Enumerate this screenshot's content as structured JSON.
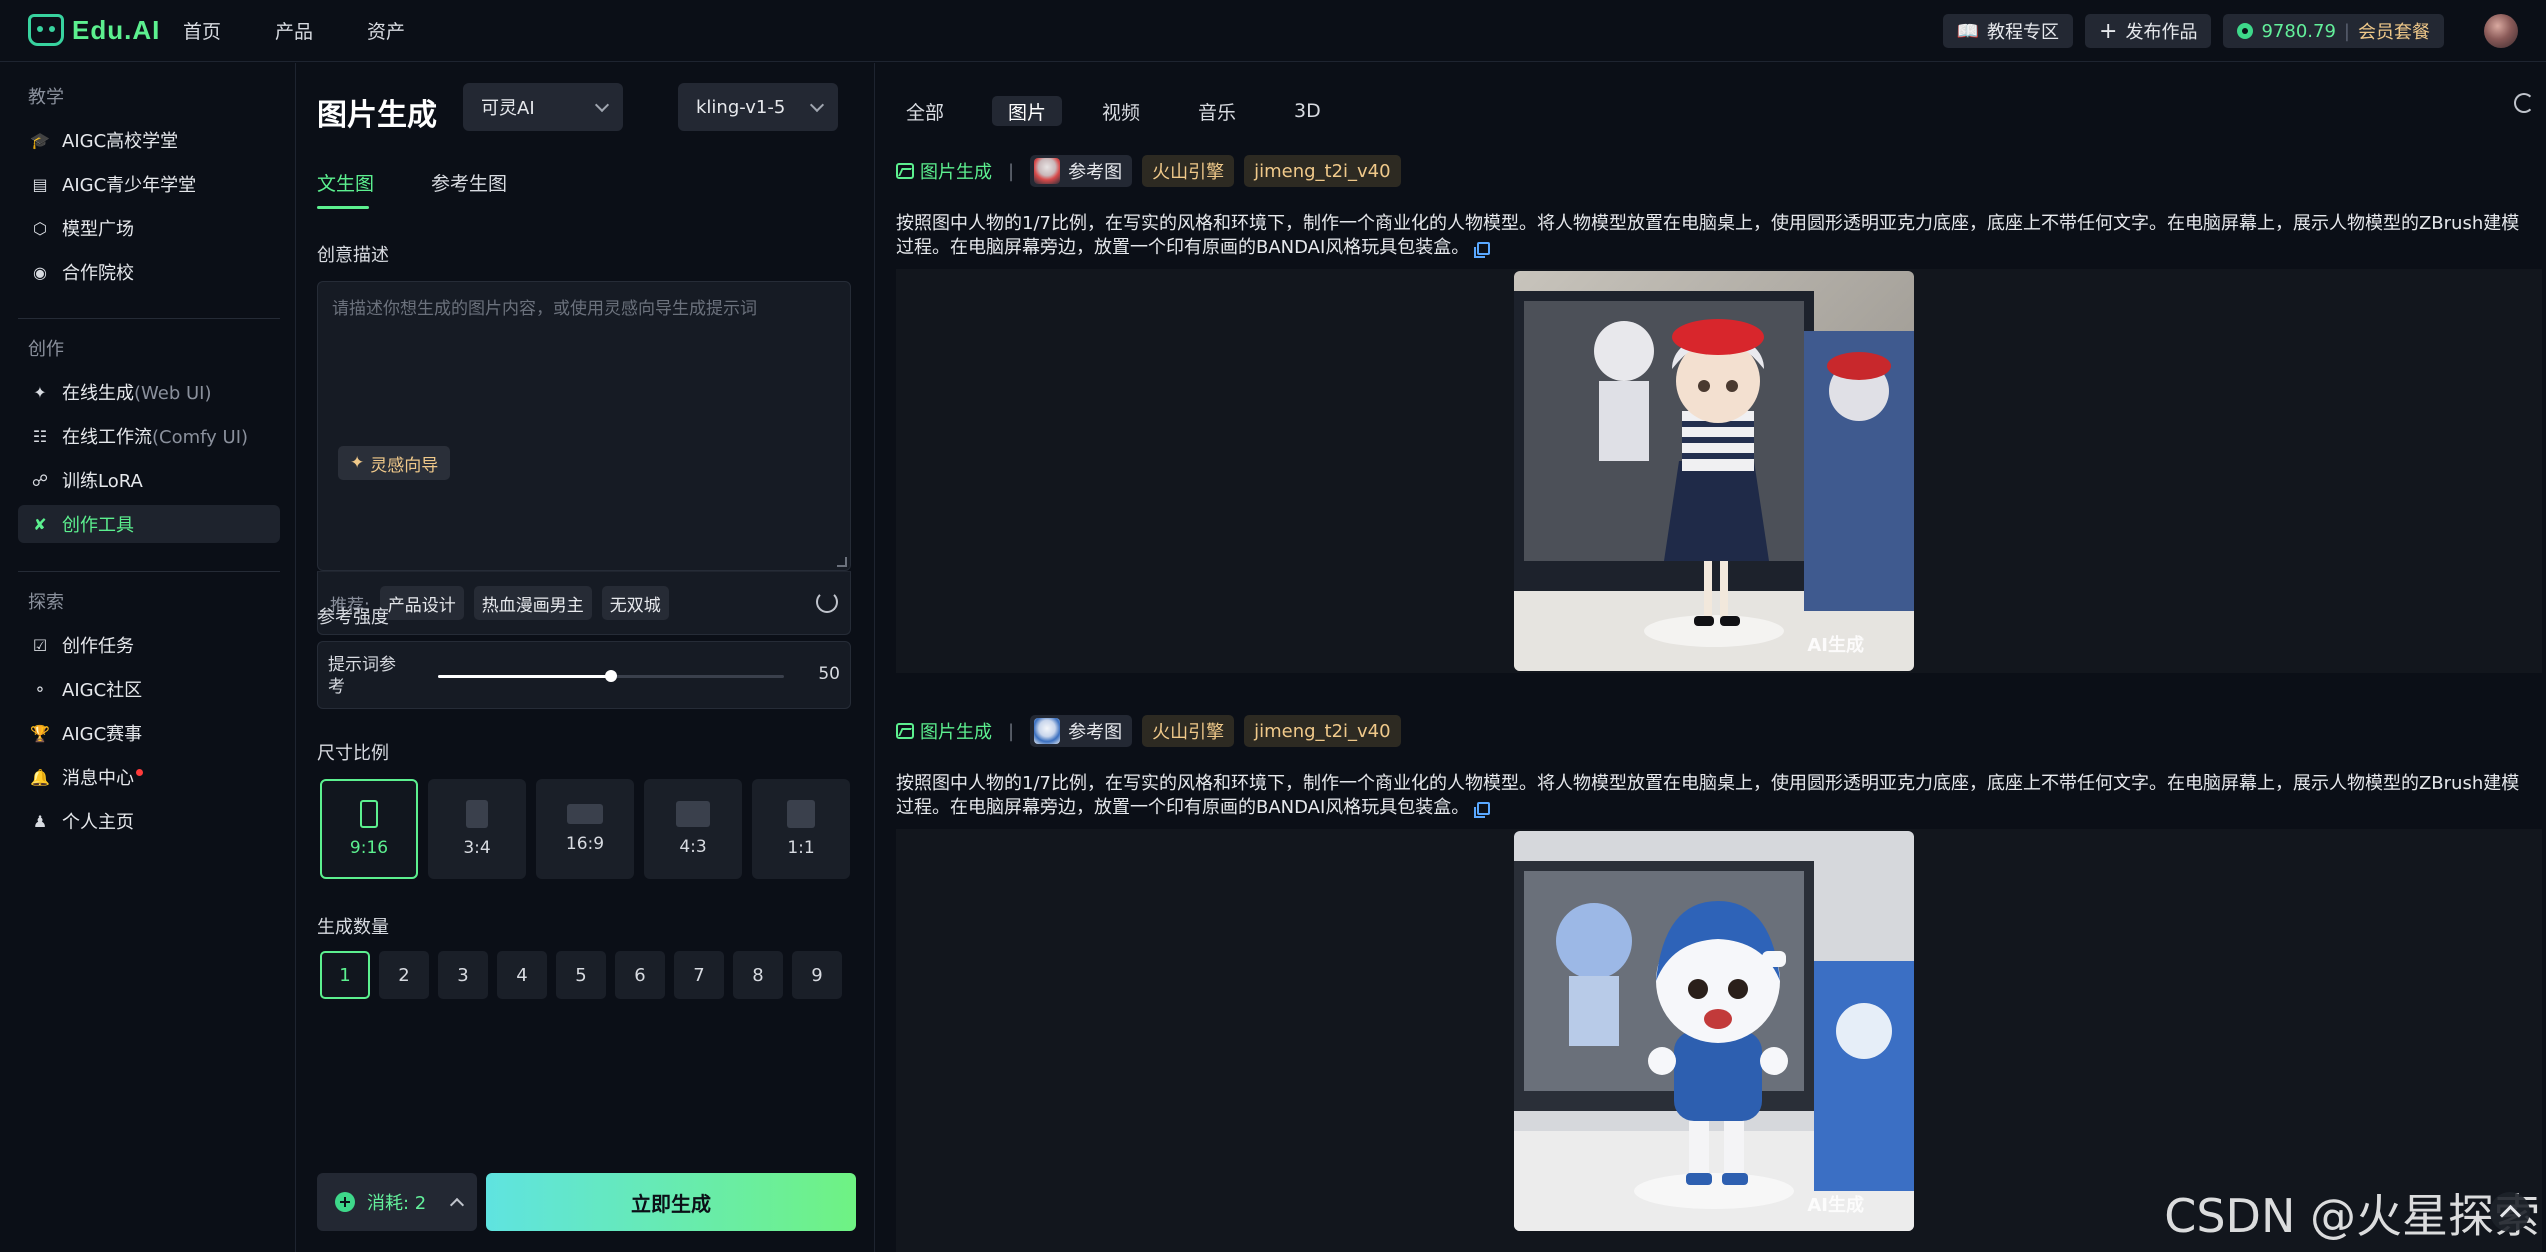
{
  "brand": {
    "logo_text": "Edu.AI",
    "accent": "#5cf08f"
  },
  "topnav": [
    "首页",
    "产品",
    "资产"
  ],
  "topright": {
    "tutorial": "教程专区",
    "publish": "发布作品",
    "credits": "9780.79",
    "member": "会员套餐"
  },
  "sidebar": {
    "sections": [
      {
        "title": "教学",
        "items": [
          {
            "label": "AIGC高校学堂",
            "icon": "graduation-cap-icon"
          },
          {
            "label": "AIGC青少年学堂",
            "icon": "book-icon"
          },
          {
            "label": "模型广场",
            "icon": "cube-icon"
          },
          {
            "label": "合作院校",
            "icon": "location-pin-icon"
          }
        ]
      },
      {
        "title": "创作",
        "items": [
          {
            "label": "在线生成",
            "sub": "(Web UI)",
            "icon": "sparkle-icon"
          },
          {
            "label": "在线工作流",
            "sub": "(Comfy UI)",
            "icon": "workflow-icon"
          },
          {
            "label": "训练LoRA",
            "icon": "model-icon"
          },
          {
            "label": "创作工具",
            "icon": "tools-icon",
            "active": true
          }
        ]
      },
      {
        "title": "探索",
        "items": [
          {
            "label": "创作任务",
            "icon": "clipboard-icon"
          },
          {
            "label": "AIGC社区",
            "icon": "planet-icon"
          },
          {
            "label": "AIGC赛事",
            "icon": "trophy-icon"
          },
          {
            "label": "消息中心",
            "icon": "bell-icon",
            "badge": true
          },
          {
            "label": "个人主页",
            "icon": "user-icon"
          }
        ]
      }
    ]
  },
  "panel": {
    "title": "图片生成",
    "provider": "可灵AI",
    "model": "kling-v1-5",
    "tabs": [
      "文生图",
      "参考生图"
    ],
    "desc_label": "创意描述",
    "desc_placeholder": "请描述你想生成的图片内容，或使用灵感向导生成提示词",
    "inspire": "灵感向导",
    "rec_label": "推荐:",
    "rec_chips": [
      "产品设计",
      "热血漫画男主",
      "无双城"
    ],
    "strength_label": "参考强度",
    "slider_label": "提示词参考",
    "slider_value": "50",
    "slider_fraction": 0.5,
    "ratio_label": "尺寸比例",
    "ratios": [
      "9:16",
      "3:4",
      "16:9",
      "4:3",
      "1:1"
    ],
    "selected_ratio": "9:16",
    "qty_label": "生成数量",
    "qtys": [
      "1",
      "2",
      "3",
      "4",
      "5",
      "6",
      "7",
      "8",
      "9"
    ],
    "selected_qty": "1",
    "cost": "消耗: 2",
    "generate": "立即生成"
  },
  "main": {
    "filters": [
      "全部",
      "图片",
      "视频",
      "音乐",
      "3D"
    ],
    "active_filter": "图片",
    "results": [
      {
        "type_label": "图片生成",
        "ref_label": "参考图",
        "engine": "火山引擎",
        "model": "jimeng_t2i_v40",
        "prompt": "按照图中人物的1/7比例，在写实的风格和环境下，制作一个商业化的人物模型。将人物模型放置在电脑桌上，使用圆形透明亚克力底座，底座上不带任何文字。在电脑屏幕上，展示人物模型的ZBrush建模过程。在电脑屏幕旁边，放置一个印有原画的BANDAI风格玩具包装盒。",
        "image_tag": "AI生成"
      },
      {
        "type_label": "图片生成",
        "ref_label": "参考图",
        "engine": "火山引擎",
        "model": "jimeng_t2i_v40",
        "prompt": "按照图中人物的1/7比例，在写实的风格和环境下，制作一个商业化的人物模型。将人物模型放置在电脑桌上，使用圆形透明亚克力底座，底座上不带任何文字。在电脑屏幕上，展示人物模型的ZBrush建模过程。在电脑屏幕旁边，放置一个印有原画的BANDAI风格玩具包装盒。",
        "image_tag": "AI生成"
      }
    ]
  },
  "watermark": "CSDN @火星探索"
}
